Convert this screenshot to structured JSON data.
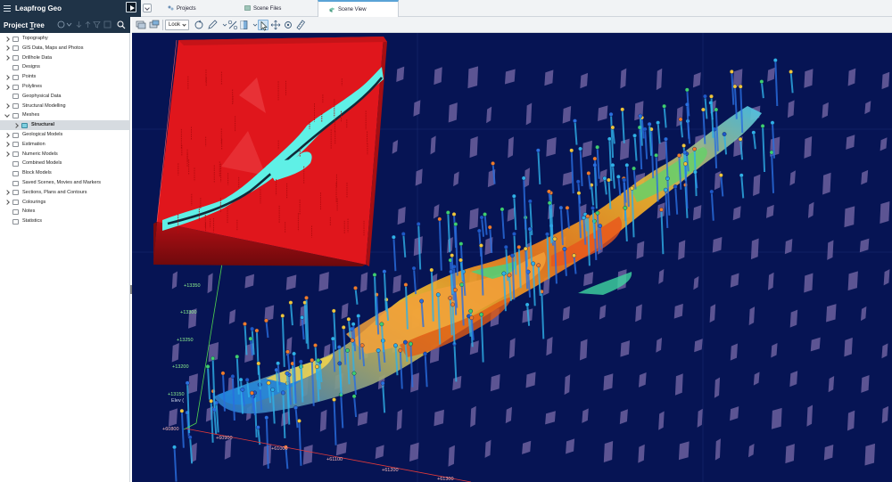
{
  "app": {
    "title": "Leapfrog Geo",
    "icons": {
      "menu": "hamburger-icon",
      "play": "play-icon"
    }
  },
  "tabs": [
    {
      "label": "Projects",
      "icon": "projects-icon",
      "active": false
    },
    {
      "label": "Scene Files",
      "icon": "scene-files-icon",
      "active": false
    },
    {
      "label": "Scene View",
      "icon": "scene-view-icon",
      "active": true
    }
  ],
  "project_tree": {
    "title_prefix": "Project ",
    "title_underlined": "T",
    "title_suffix": "ree",
    "items": [
      {
        "label": "Topography",
        "expandable": true
      },
      {
        "label": "GIS Data, Maps and Photos",
        "expandable": true
      },
      {
        "label": "Drillhole Data",
        "expandable": true
      },
      {
        "label": "Designs",
        "expandable": false
      },
      {
        "label": "Points",
        "expandable": true
      },
      {
        "label": "Polylines",
        "expandable": true
      },
      {
        "label": "Geophysical Data",
        "expandable": false
      },
      {
        "label": "Structural Modelling",
        "expandable": true
      },
      {
        "label": "Meshes",
        "expandable": true,
        "expanded": true
      },
      {
        "label": "Structural",
        "expandable": true,
        "child": true,
        "selected": true
      },
      {
        "label": "Geological Models",
        "expandable": true
      },
      {
        "label": "Estimation",
        "expandable": true
      },
      {
        "label": "Numeric Models",
        "expandable": true
      },
      {
        "label": "Combined Models",
        "expandable": false
      },
      {
        "label": "Block Models",
        "expandable": false
      },
      {
        "label": "Saved Scenes, Movies and Markers",
        "expandable": false
      },
      {
        "label": "Sections, Plans and Contours",
        "expandable": true
      },
      {
        "label": "Colourings",
        "expandable": true
      },
      {
        "label": "Notes",
        "expandable": false
      },
      {
        "label": "Statistics",
        "expandable": false
      }
    ]
  },
  "toolbar": {
    "look_label": "Look"
  },
  "scene": {
    "background": "#061454",
    "y_axis_labels": [
      "+13350",
      "+13300",
      "+13250",
      "+13200",
      "+13150"
    ],
    "elev_label": "Elev (",
    "x_axis_labels": [
      "+60800",
      "+60900",
      "+61000",
      "+61100",
      "+61200",
      "+61300"
    ],
    "colors": {
      "inset_red": "#e0161c",
      "orebody_cyan": "#5ff0e6",
      "axis_green": "#4fd34f",
      "axis_red": "#e03a3a"
    }
  }
}
